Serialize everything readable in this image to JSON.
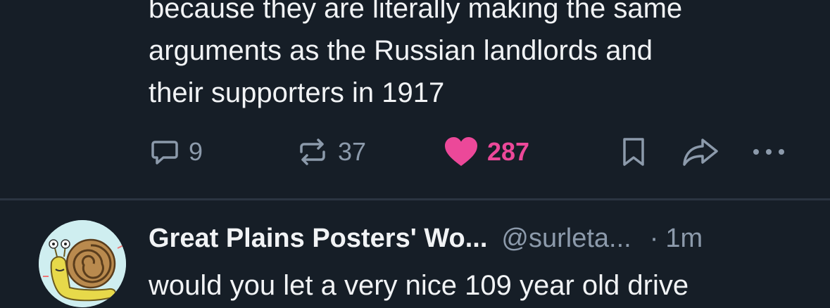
{
  "post1": {
    "text_lines": [
      "because they are literally making the same",
      "arguments as the Russian landlords and",
      "their supporters in 1917"
    ],
    "actions": {
      "replies": "9",
      "reposts": "37",
      "likes": "287",
      "liked": true
    },
    "colors": {
      "like_accent": "#ec4899",
      "muted": "#8c9aab"
    }
  },
  "post2": {
    "author": "Great Plains Posters' Wo...",
    "handle": "@surleta...",
    "separator": "·",
    "time": "1m",
    "text": "would you let a very nice 109 year old drive",
    "avatar_icon": "snail-avatar-icon"
  },
  "theme": {
    "background": "#161e27",
    "divider": "#2b3542"
  }
}
